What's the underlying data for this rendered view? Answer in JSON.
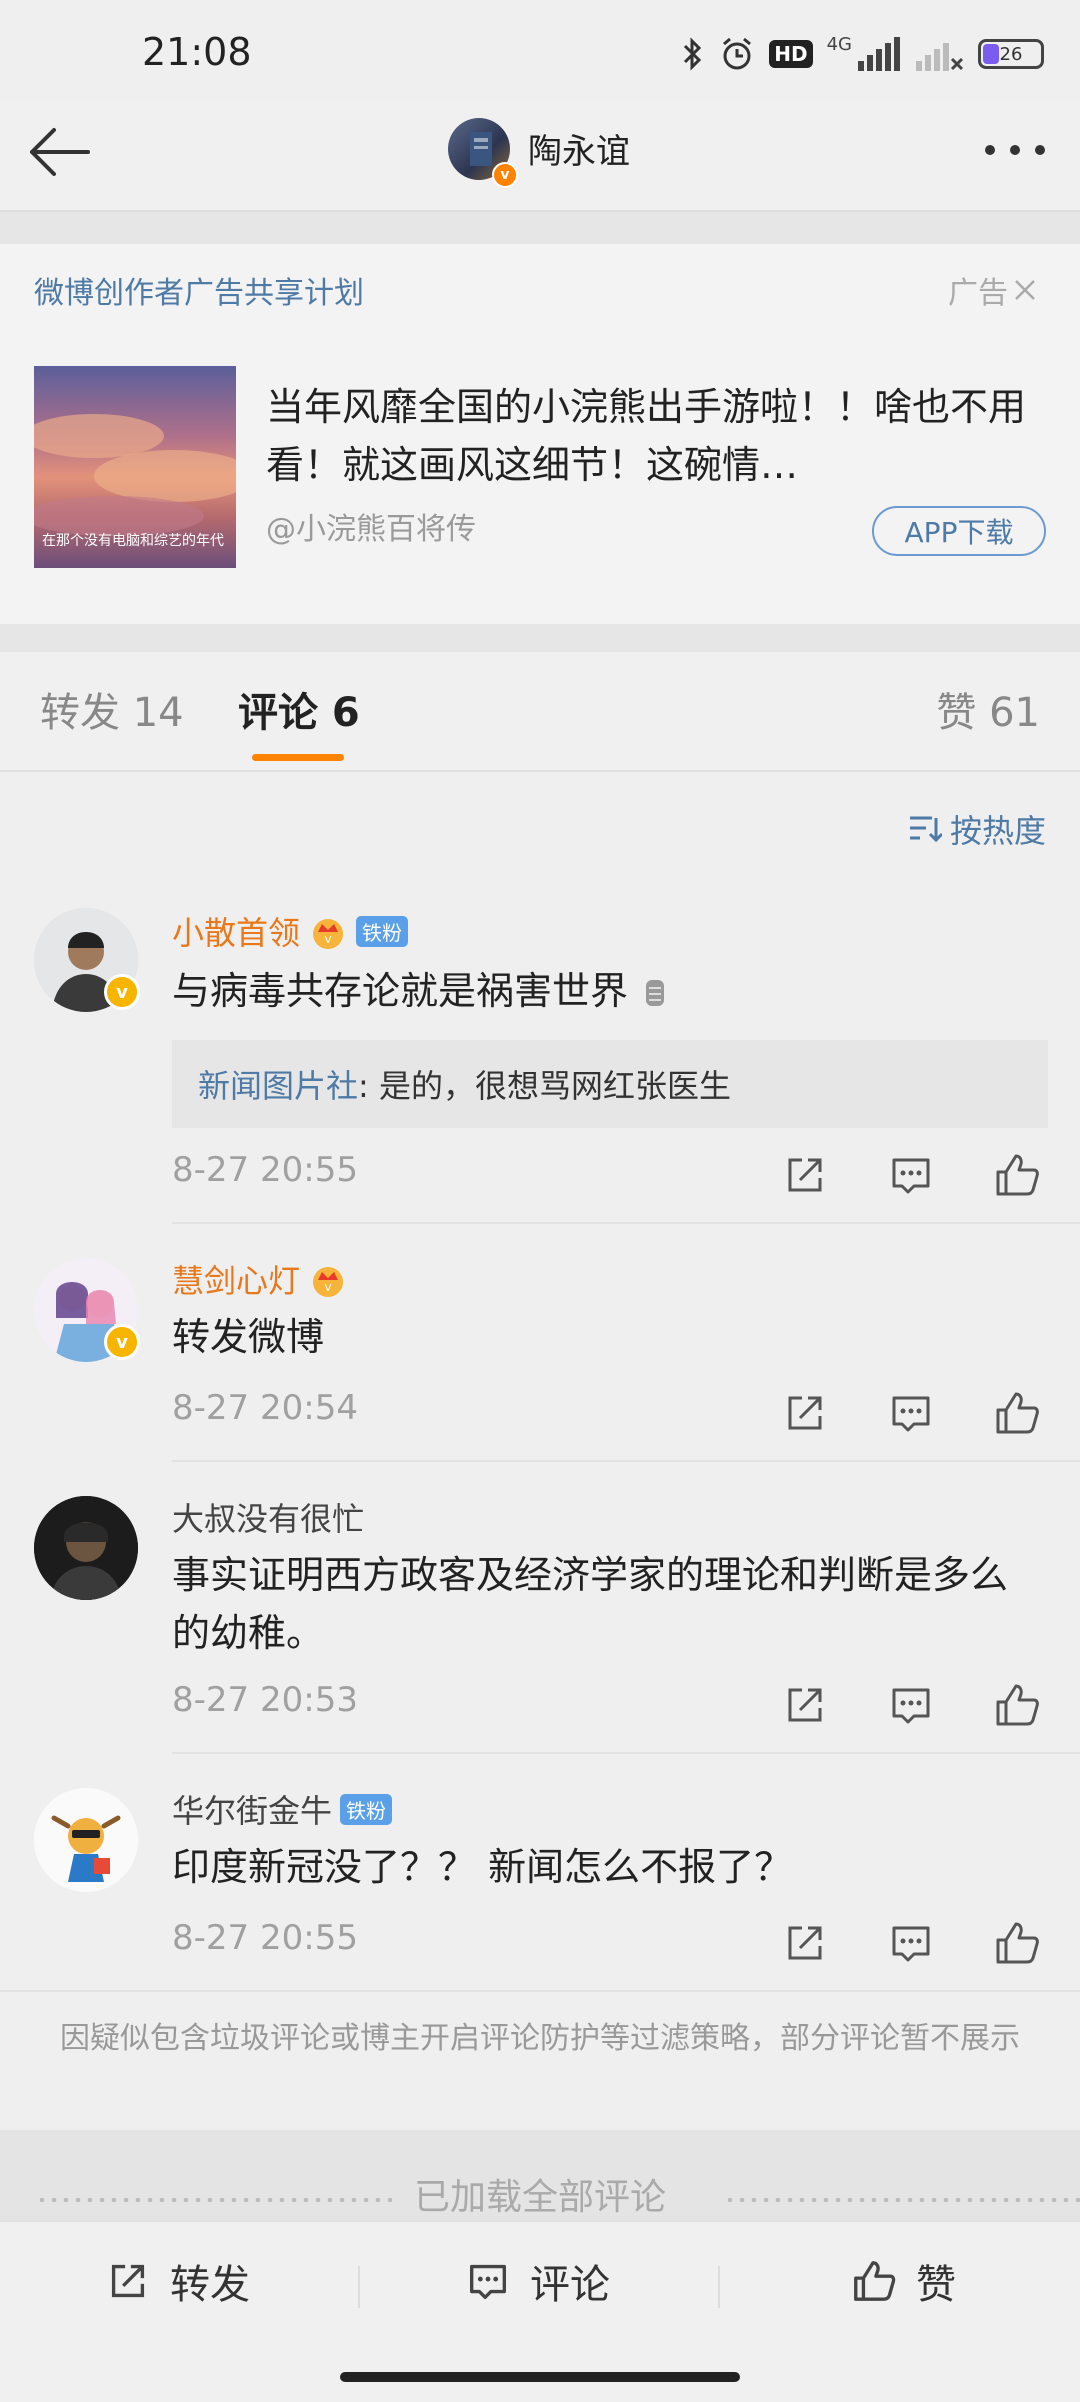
{
  "status_bar": {
    "time": "21:08",
    "network": "4G",
    "battery": "26"
  },
  "header": {
    "title": "陶永谊"
  },
  "ad": {
    "plan_label": "微博创作者广告共享计划",
    "ad_label": "广告",
    "image_caption": "在那个没有电脑和综艺的年代",
    "title": "当年风靡全国的小浣熊出手游啦！！啥也不用看！就这画风这细节！这碗情…",
    "source": "@小浣熊百将传",
    "button": "APP下载"
  },
  "tabs": {
    "repost": "转发 14",
    "comment": "评论 6",
    "like": "赞 61"
  },
  "sort_label": "按热度",
  "comments": [
    {
      "name": "小散首领",
      "badge": "铁粉",
      "text": "与病毒共存论就是祸害世界",
      "reply_user": "新闻图片社",
      "reply_text": ": 是的，很想骂网红张医生",
      "time": "8-27 20:55"
    },
    {
      "name": "慧剑心灯",
      "text": "转发微博",
      "time": "8-27 20:54"
    },
    {
      "name": "大叔没有很忙",
      "text": "事实证明西方政客及经济学家的理论和判断是多么的幼稚。",
      "time": "8-27 20:53"
    },
    {
      "name": "华尔街金牛",
      "badge": "铁粉",
      "text": "印度新冠没了？？ 新闻怎么不报了？",
      "time": "8-27 20:55"
    }
  ],
  "filter_note": "因疑似包含垃圾评论或博主开启评论防护等过滤策略，部分评论暂不展示",
  "loaded_text": "已加载全部评论",
  "bottom_bar": {
    "repost": "转发",
    "comment": "评论",
    "like": "赞"
  },
  "colors": {
    "accent": "#ff8200",
    "link": "#4e7aa6",
    "name_vip": "#e8781a",
    "fan_badge": "#5aa0e8"
  }
}
